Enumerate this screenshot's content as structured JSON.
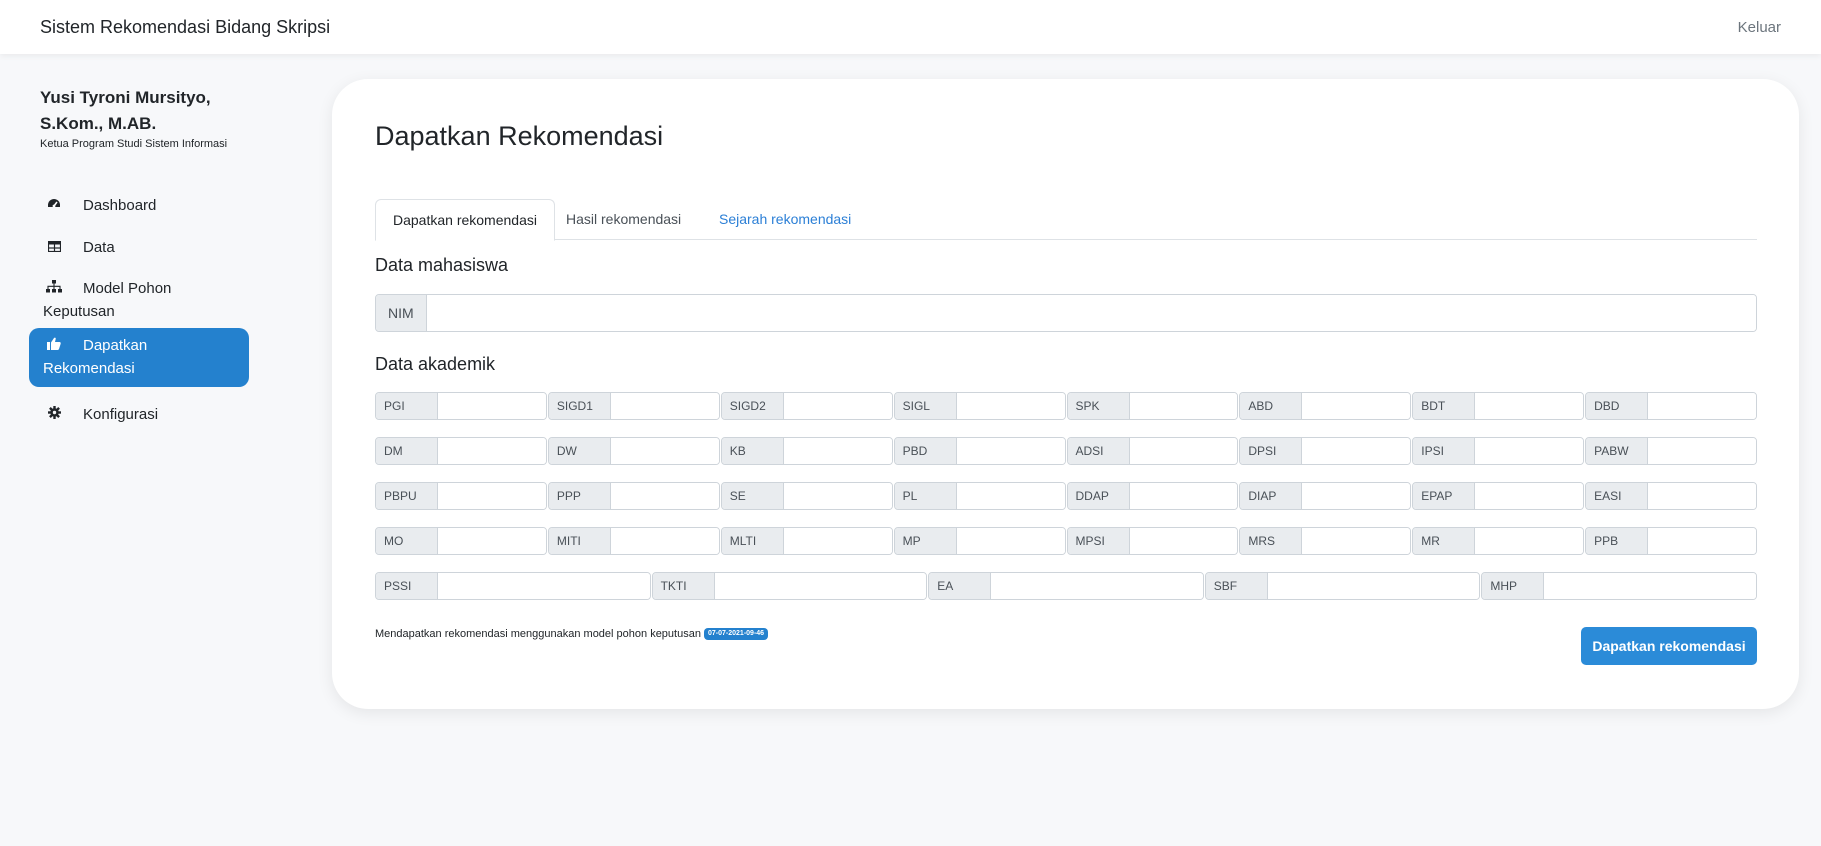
{
  "navbar": {
    "brand": "Sistem Rekomendasi Bidang Skripsi",
    "logout": "Keluar"
  },
  "sidebar": {
    "user_name": "Yusi Tyroni Mursityo, S.Kom., M.AB.",
    "user_role": "Ketua Program Studi Sistem Informasi",
    "items": [
      {
        "label": "Dashboard",
        "icon": "tachometer-icon"
      },
      {
        "label": "Data",
        "icon": "table-icon"
      },
      {
        "label": "Model Pohon Keputusan",
        "icon": "sitemap-icon"
      },
      {
        "label": "Dapatkan Rekomendasi",
        "icon": "thumbs-up-icon"
      },
      {
        "label": "Konfigurasi",
        "icon": "gear-icon"
      }
    ]
  },
  "main": {
    "title": "Dapatkan Rekomendasi",
    "tabs": [
      {
        "label": "Dapatkan rekomendasi"
      },
      {
        "label": "Hasil rekomendasi"
      },
      {
        "label": "Sejarah rekomendasi"
      }
    ],
    "student_section": "Data mahasiswa",
    "nim_label": "NIM",
    "academic_section": "Data akademik",
    "rows": [
      [
        "PGI",
        "SIGD1",
        "SIGD2",
        "SIGL",
        "SPK",
        "ABD",
        "BDT",
        "DBD"
      ],
      [
        "DM",
        "DW",
        "KB",
        "PBD",
        "ADSI",
        "DPSI",
        "IPSI",
        "PABW"
      ],
      [
        "PBPU",
        "PPP",
        "SE",
        "PL",
        "DDAP",
        "DIAP",
        "EPAP",
        "EASI"
      ],
      [
        "MO",
        "MITI",
        "MLTI",
        "MP",
        "MPSI",
        "MRS",
        "MR",
        "PPB"
      ],
      [
        "PSSI",
        "TKTI",
        "EA",
        "SBF",
        "MHP"
      ]
    ],
    "footnote": "Mendapatkan rekomendasi menggunakan model pohon keputusan",
    "model_badge": "07-07-2021-09-46",
    "submit_label": "Dapatkan rekomendasi"
  },
  "colors": {
    "accent": "#2481ce",
    "link": "#2b7fd6",
    "background": "#f7f8fa"
  }
}
